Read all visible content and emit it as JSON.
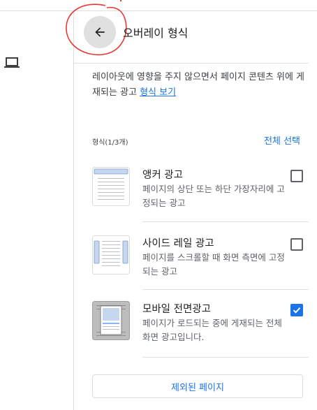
{
  "header": {
    "title": "오버레이 형식",
    "back_icon": "arrow-back-icon"
  },
  "left_rail": {
    "icon": "laptop-icon"
  },
  "description": {
    "text": "레이아웃에 영향을 주지 않으면서 페이지 콘텐츠 위에 게재되는 광고 ",
    "link": "형식 보기"
  },
  "formats": {
    "count_label": "형식(1/3개)",
    "select_all": "전체 선택",
    "items": [
      {
        "name": "앵커 광고",
        "description": "페이지의 상단 또는 하단 가장자리에 고정되는 광고",
        "checked": false
      },
      {
        "name": "사이드 레일 광고",
        "description": "페이지를 스크롤할 때 화면 측면에 고정되는 광고",
        "checked": false
      },
      {
        "name": "모바일 전면광고",
        "description": "페이지가 로드되는 중에 게재되는 전체 화면 광고입니다.",
        "checked": true
      }
    ]
  },
  "footer": {
    "excluded_pages_label": "제외된 페이지"
  },
  "colors": {
    "accent": "#1a73e8",
    "annotation": "#e53935",
    "divider": "#e0e0e0"
  }
}
